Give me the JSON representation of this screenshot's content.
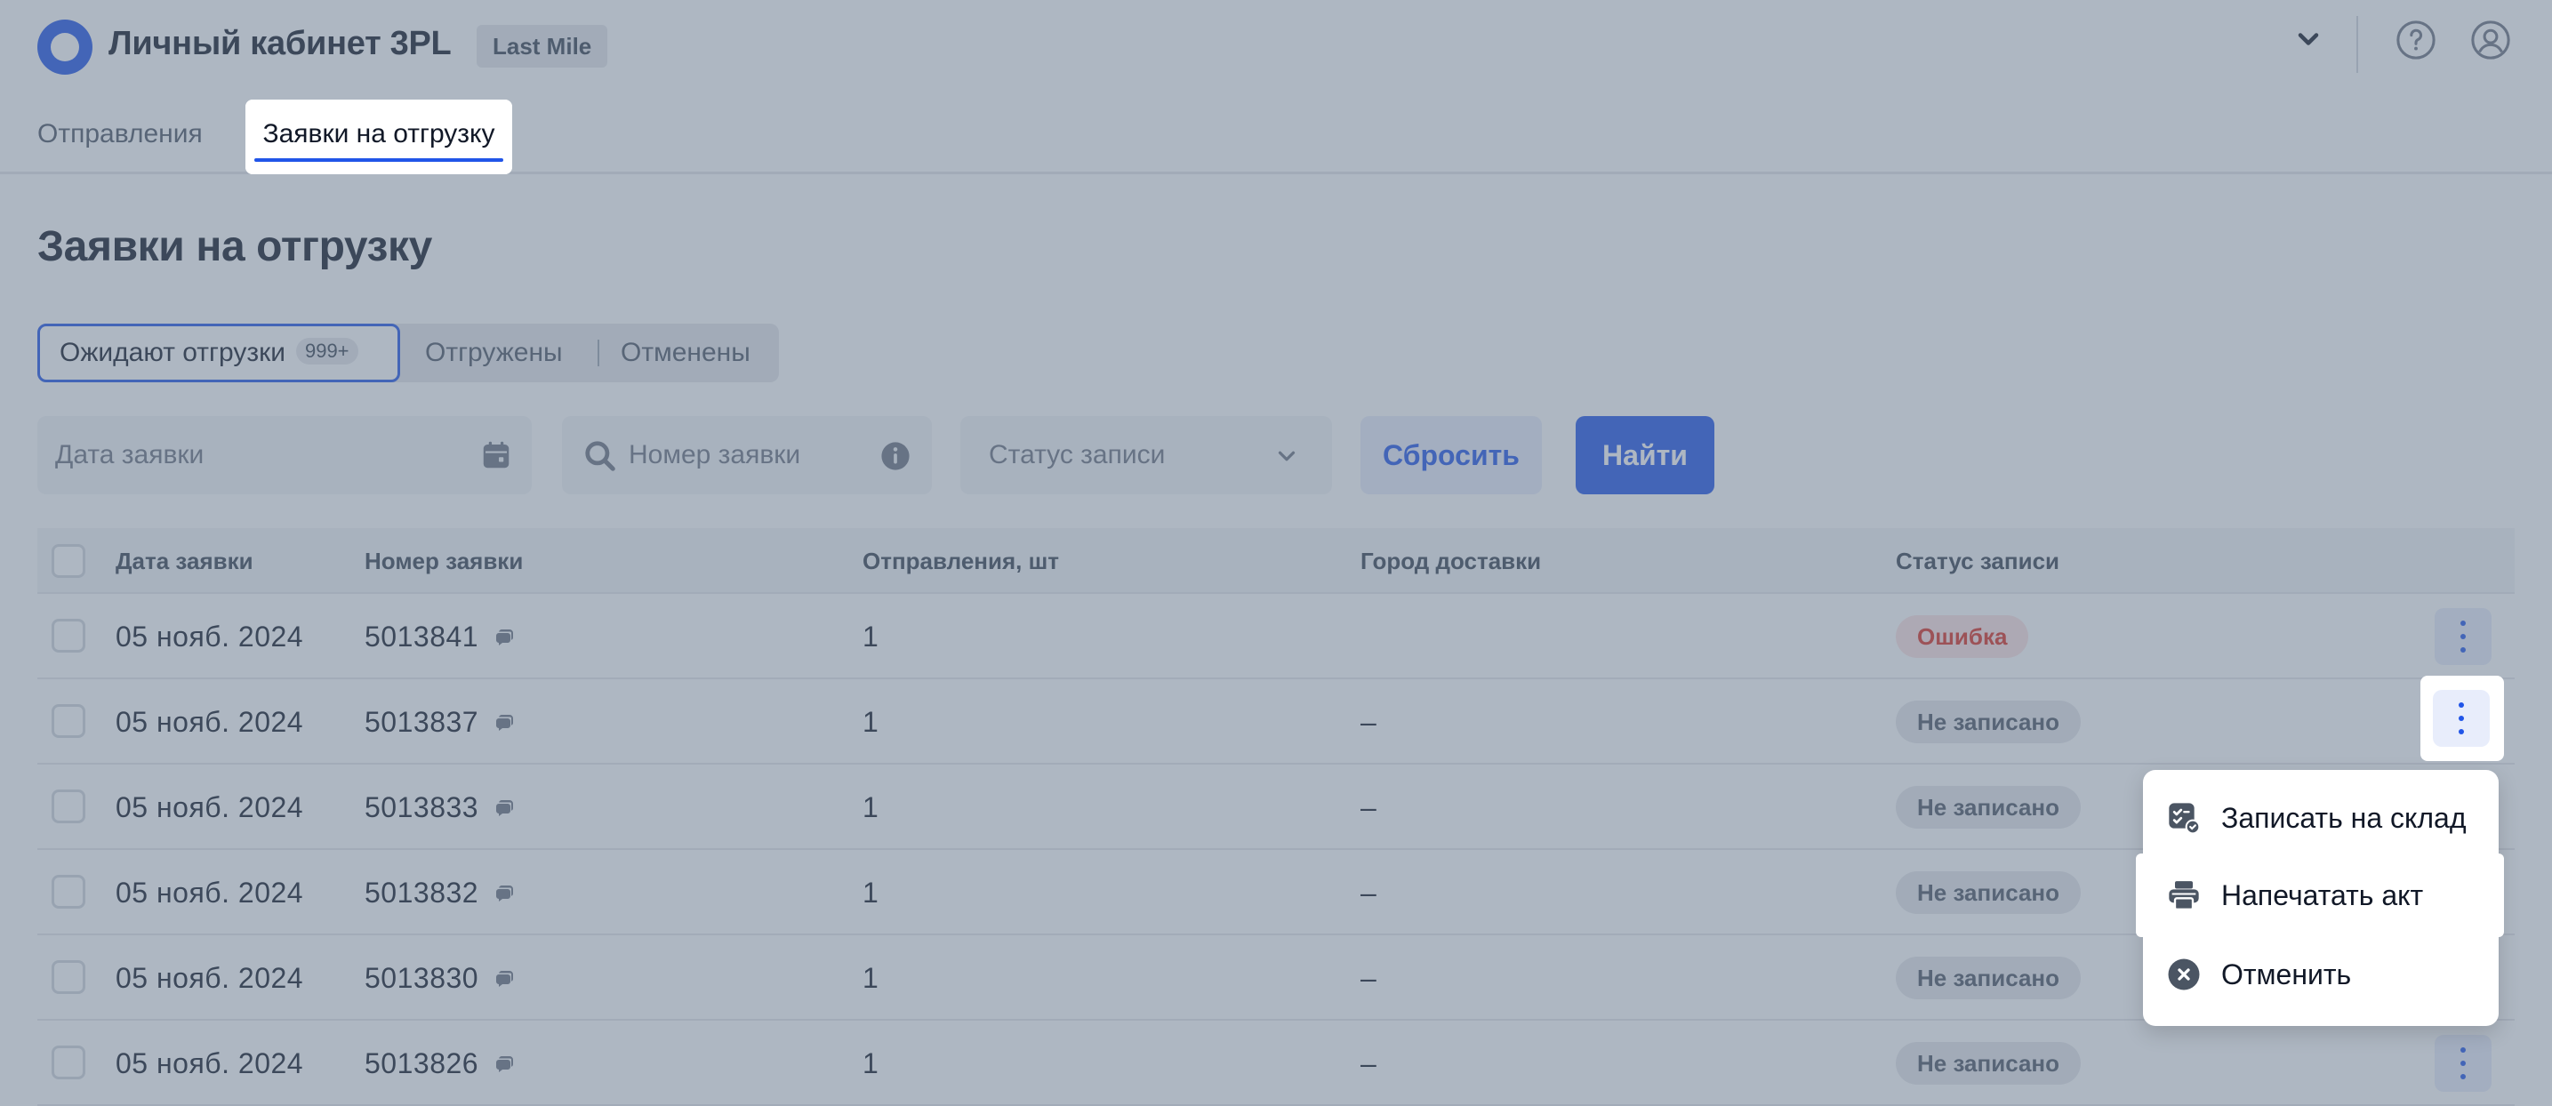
{
  "header": {
    "app_title": "Личный кабинет 3PL",
    "badge": "Last Mile"
  },
  "tabs": [
    {
      "label": "Отправления",
      "active": false
    },
    {
      "label": "Заявки на отгрузку",
      "active": true
    }
  ],
  "page_title": "Заявки на отгрузку",
  "segments": {
    "awaiting": {
      "label": "Ожидают отгрузки",
      "count": "999+"
    },
    "shipped": {
      "label": "Отгружены"
    },
    "cancelled": {
      "label": "Отменены"
    }
  },
  "filters": {
    "date_placeholder": "Дата заявки",
    "number_placeholder": "Номер заявки",
    "status_placeholder": "Статус записи",
    "reset_label": "Сбросить",
    "find_label": "Найти"
  },
  "table": {
    "headers": {
      "date": "Дата заявки",
      "number": "Номер заявки",
      "shipments": "Отправления, шт",
      "city": "Город доставки",
      "status": "Статус записи"
    },
    "rows": [
      {
        "date": "05 нояб. 2024",
        "number": "5013841",
        "shipments": "1",
        "city": "",
        "status": "Ошибка",
        "status_kind": "error"
      },
      {
        "date": "05 нояб. 2024",
        "number": "5013837",
        "shipments": "1",
        "city": "–",
        "status": "Не записано",
        "status_kind": "none"
      },
      {
        "date": "05 нояб. 2024",
        "number": "5013833",
        "shipments": "1",
        "city": "–",
        "status": "Не записано",
        "status_kind": "none"
      },
      {
        "date": "05 нояб. 2024",
        "number": "5013832",
        "shipments": "1",
        "city": "–",
        "status": "Не записано",
        "status_kind": "none"
      },
      {
        "date": "05 нояб. 2024",
        "number": "5013830",
        "shipments": "1",
        "city": "–",
        "status": "Не записано",
        "status_kind": "none"
      },
      {
        "date": "05 нояб. 2024",
        "number": "5013826",
        "shipments": "1",
        "city": "–",
        "status": "Не записано",
        "status_kind": "none"
      }
    ]
  },
  "menu": {
    "items": [
      {
        "label": "Записать на склад",
        "icon": "warehouse-check-icon"
      },
      {
        "label": "Напечатать акт",
        "icon": "printer-icon"
      },
      {
        "label": "Отменить",
        "icon": "cancel-circle-icon"
      }
    ]
  },
  "colors": {
    "accent": "#2155e8",
    "error_text": "#d92d20",
    "error_bg": "#fde2e2"
  }
}
